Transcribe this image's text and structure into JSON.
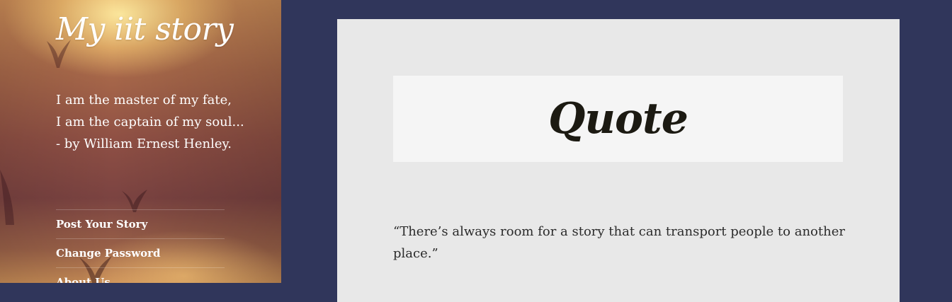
{
  "site": {
    "title": "My iit story",
    "tagline": {
      "line1": "I am the master of my fate,",
      "line2": "I am the captain of my soul...",
      "line3": "- by William Ernest Henley."
    }
  },
  "nav": {
    "items": [
      {
        "label": "Post Your Story"
      },
      {
        "label": "Change Password"
      },
      {
        "label": "About Us"
      }
    ]
  },
  "post": {
    "title": "Quote",
    "body": "“There’s always room for a story that can transport people to another place.”"
  },
  "colors": {
    "page_background": "#30365b",
    "content_background": "#e8e8e8",
    "header_background": "#f5f5f5"
  }
}
